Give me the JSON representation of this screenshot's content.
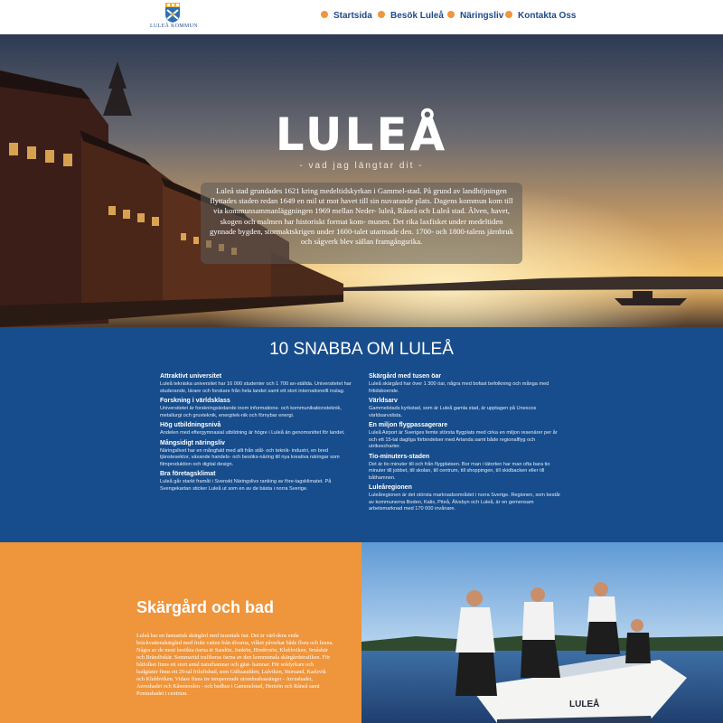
{
  "header": {
    "logo_text": "LULEÅ KOMMUN",
    "logo_icon": "luleå-coat-of-arms",
    "nav": [
      {
        "label": "Startsida"
      },
      {
        "label": "Besök Luleå"
      },
      {
        "label": "Näringsliv"
      },
      {
        "label": "Kontakta Oss"
      }
    ],
    "accent_color": "#f0963c",
    "nav_color": "#1f4a8c"
  },
  "hero": {
    "title": "LULEÅ",
    "subtitle": "- vad jag längtar dit -",
    "text": "Luleå stad grundades 1621 kring medeltidskyrkan i Gammel-stad. På grund av landhöjningen flyttades staden redan 1649 en mil ut mot havet till sin nuvarande plats. Dagens kommun kom till via kommunsammanläggningen 1969 mellan Neder- luleå, Råneå och Luleå stad. Älven, havet, skogen och malmen har historiskt format kom- munen. Det rika laxfisket under medeltiden gynnade bygden, stormaktskrigen under 1600-talet utarmade den. 1700- och 1800-talens järnbruk och sågverk blev sällan framgångsrika."
  },
  "facts": {
    "title": "10 SNABBA OM LULEÅ",
    "background": "#174d8c",
    "left": [
      {
        "heading": "Attraktivt universitet",
        "text": "Luleå tekniska universitet har 16 000 studenter och 1 700 an-ställda. Universitetet har studerande, lärare och forskare från hela landet samt ett stort internationellt inslag."
      },
      {
        "heading": "Forskning i världsklass",
        "text": "Universitetet är forskningsledande inom informations- och kommunikationsteknik, metallurgi och gruvteknik, energitek-nik och förnybar energi."
      },
      {
        "heading": "Hög utbildningsnivå",
        "text": "Andelen med eftergymnasial utbildning är högre i Luleå än genomsnittet för landet."
      },
      {
        "heading": "Mångsidigt näringsliv",
        "text": "Näringslivet har en mångfald med allt från stål- och teknik- industri, en bred tjänstesektor, växande handels- och besöks-näring till nya kreativa näringar som filmproduktion och digital design."
      },
      {
        "heading": "Bra företagsklimat",
        "text": "Luleå går starkt framåt i Svenskt Näringslivs ranking av före-tagsklimatet. På Svengekartan sticker Luleå ut som en av de bästa i norra Sverige."
      }
    ],
    "right": [
      {
        "heading": "Skärgård med tusen öar",
        "text": "Luleå skärgård har över 1 300 öar, några med bofast befolkning och många med fritidsboende."
      },
      {
        "heading": "Världsarv",
        "text": "Gammelstads kyrkstad, som är Luleå gamla stad, är upptagen på Unescos världsarvslista."
      },
      {
        "heading": "En miljon flygpassagerare",
        "text": "Luleå Airport är Sveriges femte största flygplats med cirka en miljon resenärer per år och ett 15-tal dagliga förbindelser med Arlanda samt både regionalflyg och utrikescharter."
      },
      {
        "heading": "Tio-minuters-staden",
        "text": "Det är tio minuter till och från flygplatsen. Bor man i tätorten har man ofta bara tio minuter till jobbet, till skolan, till centrum, till shoppingen, till skidbacken eller till båthamnen."
      },
      {
        "heading": "Luleåregionen",
        "text": "Luleåregionen är det största marknadsområdet i norra Sverige. Regionen, som består av kommunerna Boden, Kalix, Piteå, Älvsbyn och Luleå, är en gemensam arbetsmarknad med 170 000 invånare."
      }
    ]
  },
  "skargard": {
    "title": "Skärgård och bad",
    "text": "Luleå har en fantastisk skärgård med tusentals öar. Det är värl-dens enda bräckvattenskärgård med frukt vatten från älvarna, vilket påverkar både flora och fauna. Några av de mest besökta öarna är Sandön, Junkön, Hindersön, Klubbviken, Småskär och Brändöskär. Sommartid trafikeras öarna av den kommunala skärgårdstrafiken. För båtfolket finns ett stort antal naturhamnar och gäst- hamnar. För soldyrkare och badgäster finns ett 20-tal friluftsbad, som Gültzaudden, Lulviken, Storsand, Karlsvik och Klubbviken. Vidare finns tre tempererade utomhusbassänger - Arcusbadet, Aeroshadet och Kånenoolen - och badhus i Gammelstad, Hertsön och Råneå samt Pontusbadet i centrum.",
    "background": "#ef953c",
    "photo_boat_label": "LULEÅ"
  }
}
